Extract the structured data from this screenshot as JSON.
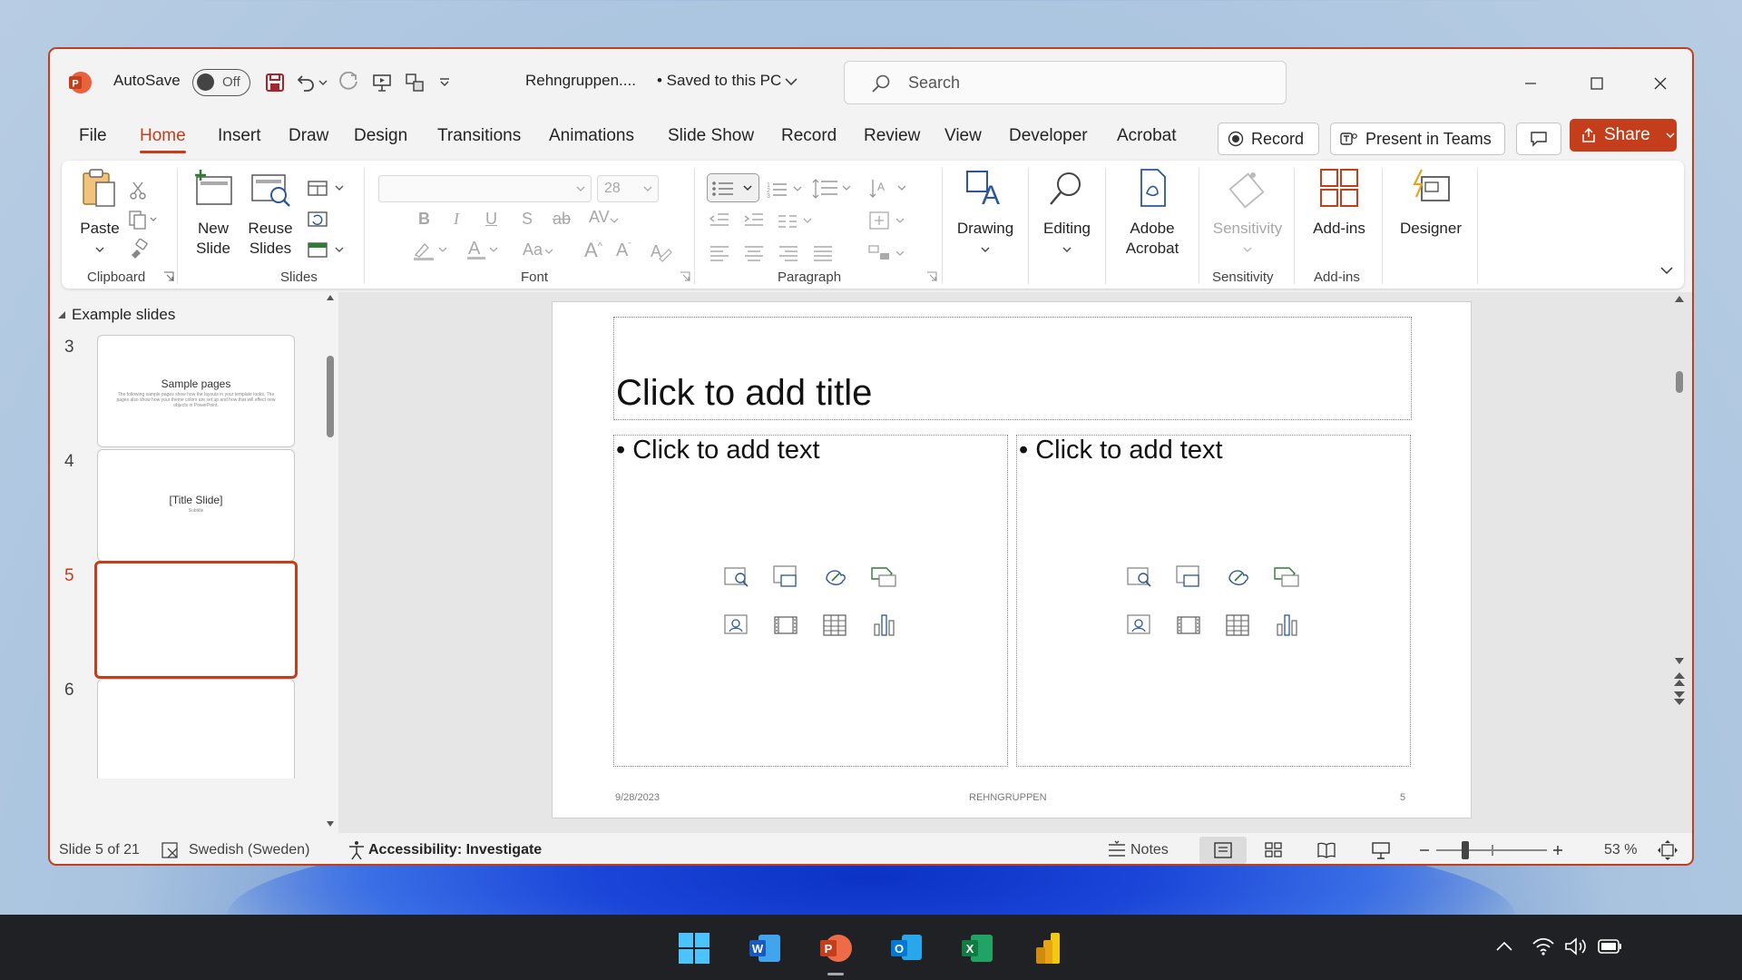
{
  "titlebar": {
    "autosave_label": "AutoSave",
    "autosave_state": "Off",
    "doc_name": "Rehngruppen....",
    "save_status": "• Saved to this PC",
    "search_placeholder": "Search"
  },
  "tabs": [
    "File",
    "Home",
    "Insert",
    "Draw",
    "Design",
    "Transitions",
    "Animations",
    "Slide Show",
    "Record",
    "Review",
    "View",
    "Developer",
    "Acrobat"
  ],
  "tab_buttons": {
    "record": "Record",
    "present": "Present in Teams",
    "share": "Share"
  },
  "ribbon": {
    "clipboard": {
      "paste": "Paste",
      "label": "Clipboard"
    },
    "slides": {
      "new_slide_1": "New",
      "new_slide_2": "Slide",
      "reuse_1": "Reuse",
      "reuse_2": "Slides",
      "label": "Slides"
    },
    "font": {
      "size": "28",
      "label": "Font"
    },
    "paragraph": {
      "label": "Paragraph"
    },
    "drawing": "Drawing",
    "editing": "Editing",
    "acrobat_1": "Adobe",
    "acrobat_2": "Acrobat",
    "sensitivity": "Sensitivity",
    "sensitivity_group": "Sensitivity",
    "addins": "Add-ins",
    "addins_group": "Add-ins",
    "designer": "Designer"
  },
  "pane": {
    "section": "Example slides",
    "slides": [
      {
        "num": "3",
        "title": "Sample pages",
        "body": "The following sample pages show how the layouts in your template looks. The pages also show how your theme colors are set up and how that will effect new objects in PowerPoint."
      },
      {
        "num": "4",
        "title": "[Title Slide]",
        "body": "Subtitle"
      },
      {
        "num": "5",
        "title": "",
        "body": ""
      },
      {
        "num": "6",
        "title": "",
        "body": ""
      }
    ]
  },
  "slide": {
    "title_ph": "Click to add title",
    "left_ph": "• Click to add text",
    "right_ph": "• Click to add text",
    "footer_date": "9/28/2023",
    "footer_center": "REHNGRUPPEN",
    "footer_num": "5"
  },
  "status": {
    "slide_of": "Slide 5 of 21",
    "language": "Swedish (Sweden)",
    "accessibility": "Accessibility: Investigate",
    "notes": "Notes",
    "zoom": "53 %"
  },
  "colors": {
    "accent": "#c43e1c",
    "ribbon_bg": "#ffffff",
    "window_bg": "#f3f3f3",
    "taskbar": "#1f2124"
  }
}
